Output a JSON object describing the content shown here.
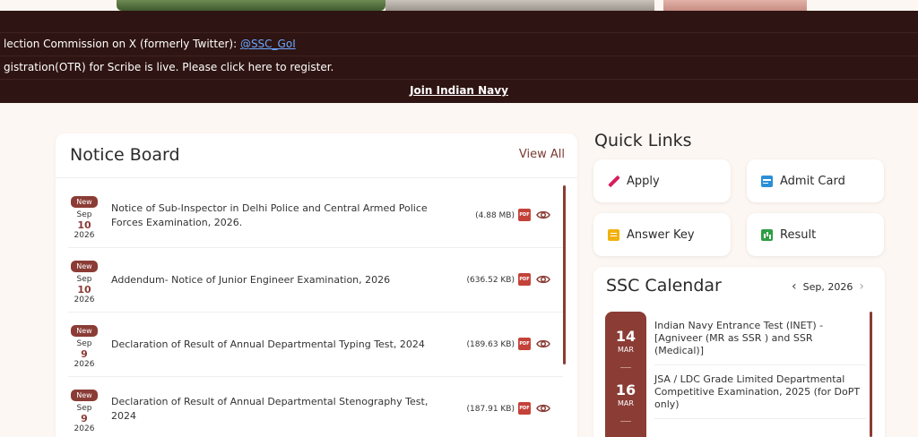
{
  "ticker": {
    "line1_text": "lection Commission on X (formerly Twitter): ",
    "line1_handle": "@SSC_GoI",
    "line2_text": "gistration(OTR) for Scribe is live. Please click here to register.",
    "line3_link": "Join Indian Navy"
  },
  "notice_board": {
    "title": "Notice Board",
    "view_all": "View All",
    "items": [
      {
        "badge": "New",
        "month": "Sep",
        "day": "10",
        "year": "2026",
        "text": "Notice of Sub-Inspector in Delhi Police and Central Armed Police Forces Examination, 2026.",
        "size": "(4.88 MB)"
      },
      {
        "badge": "New",
        "month": "Sep",
        "day": "10",
        "year": "2026",
        "text": "Addendum- Notice of Junior Engineer Examination, 2026",
        "size": "(636.52 KB)"
      },
      {
        "badge": "New",
        "month": "Sep",
        "day": "9",
        "year": "2026",
        "text": "Declaration of Result of Annual Departmental Typing Test, 2024",
        "size": "(189.63 KB)"
      },
      {
        "badge": "New",
        "month": "Sep",
        "day": "9",
        "year": "2026",
        "text": "Declaration of Result of Annual Departmental Stenography Test, 2024",
        "size": "(187.91 KB)"
      }
    ]
  },
  "quick_links": {
    "title": "Quick Links",
    "apply": "Apply",
    "admit_card": "Admit Card",
    "answer_key": "Answer Key",
    "result": "Result"
  },
  "calendar": {
    "title": "SSC Calendar",
    "month_label": "Sep, 2026",
    "events": [
      {
        "day": "14",
        "month": "MAR",
        "text": "Indian Navy Entrance Test (INET) - [Agniveer (MR as SSR ) and SSR (Medical)]"
      },
      {
        "day": "16",
        "month": "MAR",
        "text": "JSA / LDC Grade Limited Departmental Competitive Examination, 2025 (for DoPT only)"
      }
    ]
  },
  "icons": {
    "pdf": "pdf-file-icon",
    "view": "eye-icon",
    "apply": "pencil-icon",
    "admit": "id-card-icon",
    "answer": "notepad-icon",
    "result": "bar-chart-icon"
  },
  "colors": {
    "primary": "#8a3c35",
    "ticker_bg": "#2e1412",
    "page_bg": "#fdf7f3"
  }
}
